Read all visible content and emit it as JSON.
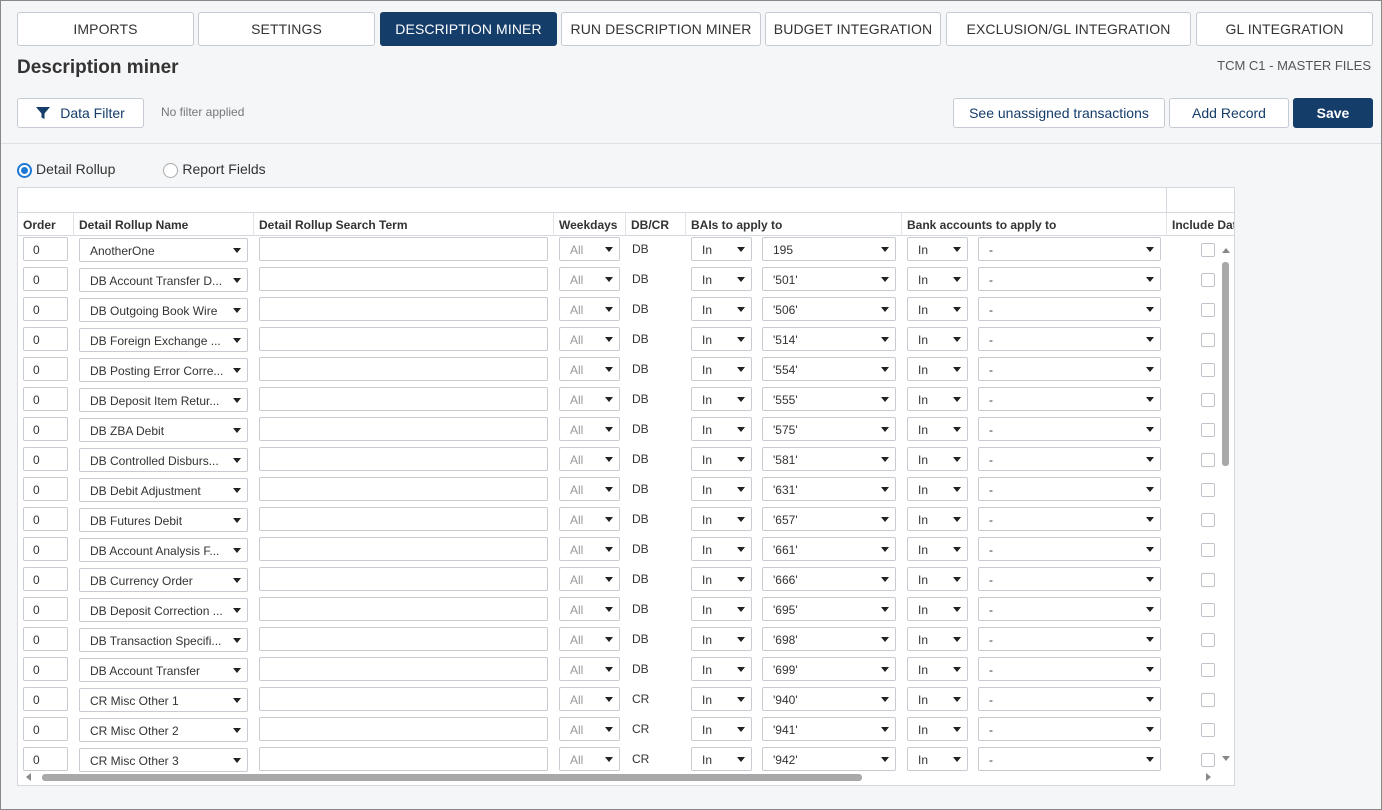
{
  "tabs": [
    {
      "label": "IMPORTS",
      "active": false
    },
    {
      "label": "SETTINGS",
      "active": false
    },
    {
      "label": "DESCRIPTION MINER",
      "active": true
    },
    {
      "label": "RUN DESCRIPTION MINER",
      "active": false
    },
    {
      "label": "BUDGET INTEGRATION",
      "active": false
    },
    {
      "label": "EXCLUSION/GL INTEGRATION",
      "active": false
    },
    {
      "label": "GL INTEGRATION",
      "active": false
    }
  ],
  "page": {
    "title": "Description miner",
    "scope": "TCM C1 - MASTER FILES"
  },
  "toolbar": {
    "data_filter_label": "Data Filter",
    "filter_status": "No filter applied",
    "unassigned_label": "See unassigned transactions",
    "add_record_label": "Add Record",
    "save_label": "Save"
  },
  "view_options": [
    {
      "label": "Detail Rollup",
      "checked": true
    },
    {
      "label": "Report Fields",
      "checked": false
    }
  ],
  "columns": [
    "Order",
    "Detail Rollup Name",
    "Detail Rollup Search Term",
    "Weekdays",
    "DB/CR",
    "BAIs to apply to",
    "Bank accounts to apply to",
    "Include Date"
  ],
  "rows": [
    {
      "order": "0",
      "name": "AnotherOne",
      "search": "",
      "weekdays": "All",
      "dbcr": "DB",
      "bai_op": "In",
      "bai": "195",
      "acct_op": "In",
      "acct": "-",
      "include": false
    },
    {
      "order": "0",
      "name": "DB Account Transfer D...",
      "search": "",
      "weekdays": "All",
      "dbcr": "DB",
      "bai_op": "In",
      "bai": "'501'",
      "acct_op": "In",
      "acct": "-",
      "include": false
    },
    {
      "order": "0",
      "name": "DB Outgoing Book Wire",
      "search": "",
      "weekdays": "All",
      "dbcr": "DB",
      "bai_op": "In",
      "bai": "'506'",
      "acct_op": "In",
      "acct": "-",
      "include": false
    },
    {
      "order": "0",
      "name": "DB Foreign Exchange ...",
      "search": "",
      "weekdays": "All",
      "dbcr": "DB",
      "bai_op": "In",
      "bai": "'514'",
      "acct_op": "In",
      "acct": "-",
      "include": false
    },
    {
      "order": "0",
      "name": "DB Posting Error Corre...",
      "search": "",
      "weekdays": "All",
      "dbcr": "DB",
      "bai_op": "In",
      "bai": "'554'",
      "acct_op": "In",
      "acct": "-",
      "include": false
    },
    {
      "order": "0",
      "name": "DB Deposit Item Retur...",
      "search": "",
      "weekdays": "All",
      "dbcr": "DB",
      "bai_op": "In",
      "bai": "'555'",
      "acct_op": "In",
      "acct": "-",
      "include": false
    },
    {
      "order": "0",
      "name": "DB ZBA Debit",
      "search": "",
      "weekdays": "All",
      "dbcr": "DB",
      "bai_op": "In",
      "bai": "'575'",
      "acct_op": "In",
      "acct": "-",
      "include": false
    },
    {
      "order": "0",
      "name": "DB Controlled Disburs...",
      "search": "",
      "weekdays": "All",
      "dbcr": "DB",
      "bai_op": "In",
      "bai": "'581'",
      "acct_op": "In",
      "acct": "-",
      "include": false
    },
    {
      "order": "0",
      "name": "DB Debit Adjustment",
      "search": "",
      "weekdays": "All",
      "dbcr": "DB",
      "bai_op": "In",
      "bai": "'631'",
      "acct_op": "In",
      "acct": "-",
      "include": false
    },
    {
      "order": "0",
      "name": "DB Futures Debit",
      "search": "",
      "weekdays": "All",
      "dbcr": "DB",
      "bai_op": "In",
      "bai": "'657'",
      "acct_op": "In",
      "acct": "-",
      "include": false
    },
    {
      "order": "0",
      "name": "DB Account Analysis F...",
      "search": "",
      "weekdays": "All",
      "dbcr": "DB",
      "bai_op": "In",
      "bai": "'661'",
      "acct_op": "In",
      "acct": "-",
      "include": false
    },
    {
      "order": "0",
      "name": "DB Currency Order",
      "search": "",
      "weekdays": "All",
      "dbcr": "DB",
      "bai_op": "In",
      "bai": "'666'",
      "acct_op": "In",
      "acct": "-",
      "include": false
    },
    {
      "order": "0",
      "name": "DB Deposit Correction ...",
      "search": "",
      "weekdays": "All",
      "dbcr": "DB",
      "bai_op": "In",
      "bai": "'695'",
      "acct_op": "In",
      "acct": "-",
      "include": false
    },
    {
      "order": "0",
      "name": "DB Transaction Specifi...",
      "search": "",
      "weekdays": "All",
      "dbcr": "DB",
      "bai_op": "In",
      "bai": "'698'",
      "acct_op": "In",
      "acct": "-",
      "include": false
    },
    {
      "order": "0",
      "name": "DB Account Transfer",
      "search": "",
      "weekdays": "All",
      "dbcr": "DB",
      "bai_op": "In",
      "bai": "'699'",
      "acct_op": "In",
      "acct": "-",
      "include": false
    },
    {
      "order": "0",
      "name": "CR Misc Other 1",
      "search": "",
      "weekdays": "All",
      "dbcr": "CR",
      "bai_op": "In",
      "bai": "'940'",
      "acct_op": "In",
      "acct": "-",
      "include": false
    },
    {
      "order": "0",
      "name": "CR Misc Other 2",
      "search": "",
      "weekdays": "All",
      "dbcr": "CR",
      "bai_op": "In",
      "bai": "'941'",
      "acct_op": "In",
      "acct": "-",
      "include": false
    },
    {
      "order": "0",
      "name": "CR Misc Other 3",
      "search": "",
      "weekdays": "All",
      "dbcr": "CR",
      "bai_op": "In",
      "bai": "'942'",
      "acct_op": "In",
      "acct": "-",
      "include": false
    }
  ],
  "colors": {
    "primary": "#153d6a",
    "radio_accent": "#1e7ad6"
  },
  "icons": {
    "filter": "funnel-icon",
    "dropdown": "chevron-down-icon"
  }
}
